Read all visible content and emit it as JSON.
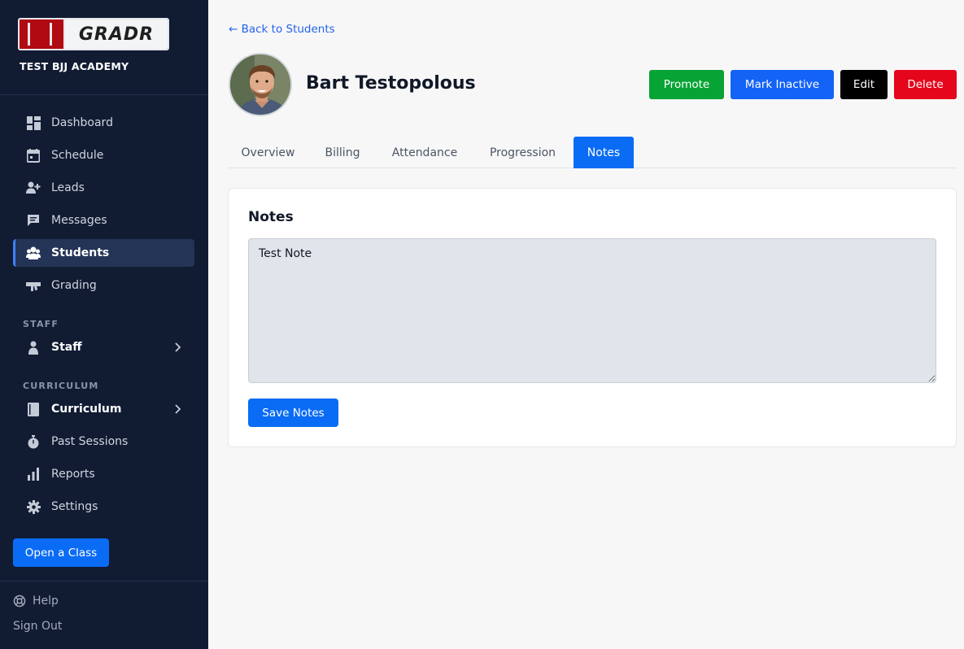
{
  "brand": {
    "logo_text": "GRADR",
    "academy": "TEST BJJ ACADEMY"
  },
  "sidebar": {
    "items": [
      {
        "label": "Dashboard",
        "icon": "dashboard-icon"
      },
      {
        "label": "Schedule",
        "icon": "calendar-icon"
      },
      {
        "label": "Leads",
        "icon": "add-user-icon"
      },
      {
        "label": "Messages",
        "icon": "message-icon"
      },
      {
        "label": "Students",
        "icon": "users-icon",
        "active": true
      },
      {
        "label": "Grading",
        "icon": "grading-icon"
      }
    ],
    "staff_section": "STAFF",
    "staff_item": "Staff",
    "curriculum_section": "CURRICULUM",
    "curriculum_item": "Curriculum",
    "more_items": [
      {
        "label": "Past Sessions",
        "icon": "stopwatch-icon"
      },
      {
        "label": "Reports",
        "icon": "bar-chart-icon"
      },
      {
        "label": "Settings",
        "icon": "gear-icon"
      }
    ],
    "open_class": "Open a Class",
    "help": "Help",
    "sign_out": "Sign Out"
  },
  "header": {
    "back_link": "← Back to Students",
    "student_name": "Bart Testopolous",
    "actions": {
      "promote": "Promote",
      "mark_inactive": "Mark Inactive",
      "edit": "Edit",
      "delete": "Delete"
    }
  },
  "tabs": [
    "Overview",
    "Billing",
    "Attendance",
    "Progression",
    "Notes"
  ],
  "active_tab": "Notes",
  "notes": {
    "title": "Notes",
    "value": "Test Note",
    "save_label": "Save Notes"
  },
  "colors": {
    "sidebar_bg": "#111c33",
    "primary": "#0a6cf5",
    "promote": "#08a335",
    "delete": "#e5061b"
  }
}
